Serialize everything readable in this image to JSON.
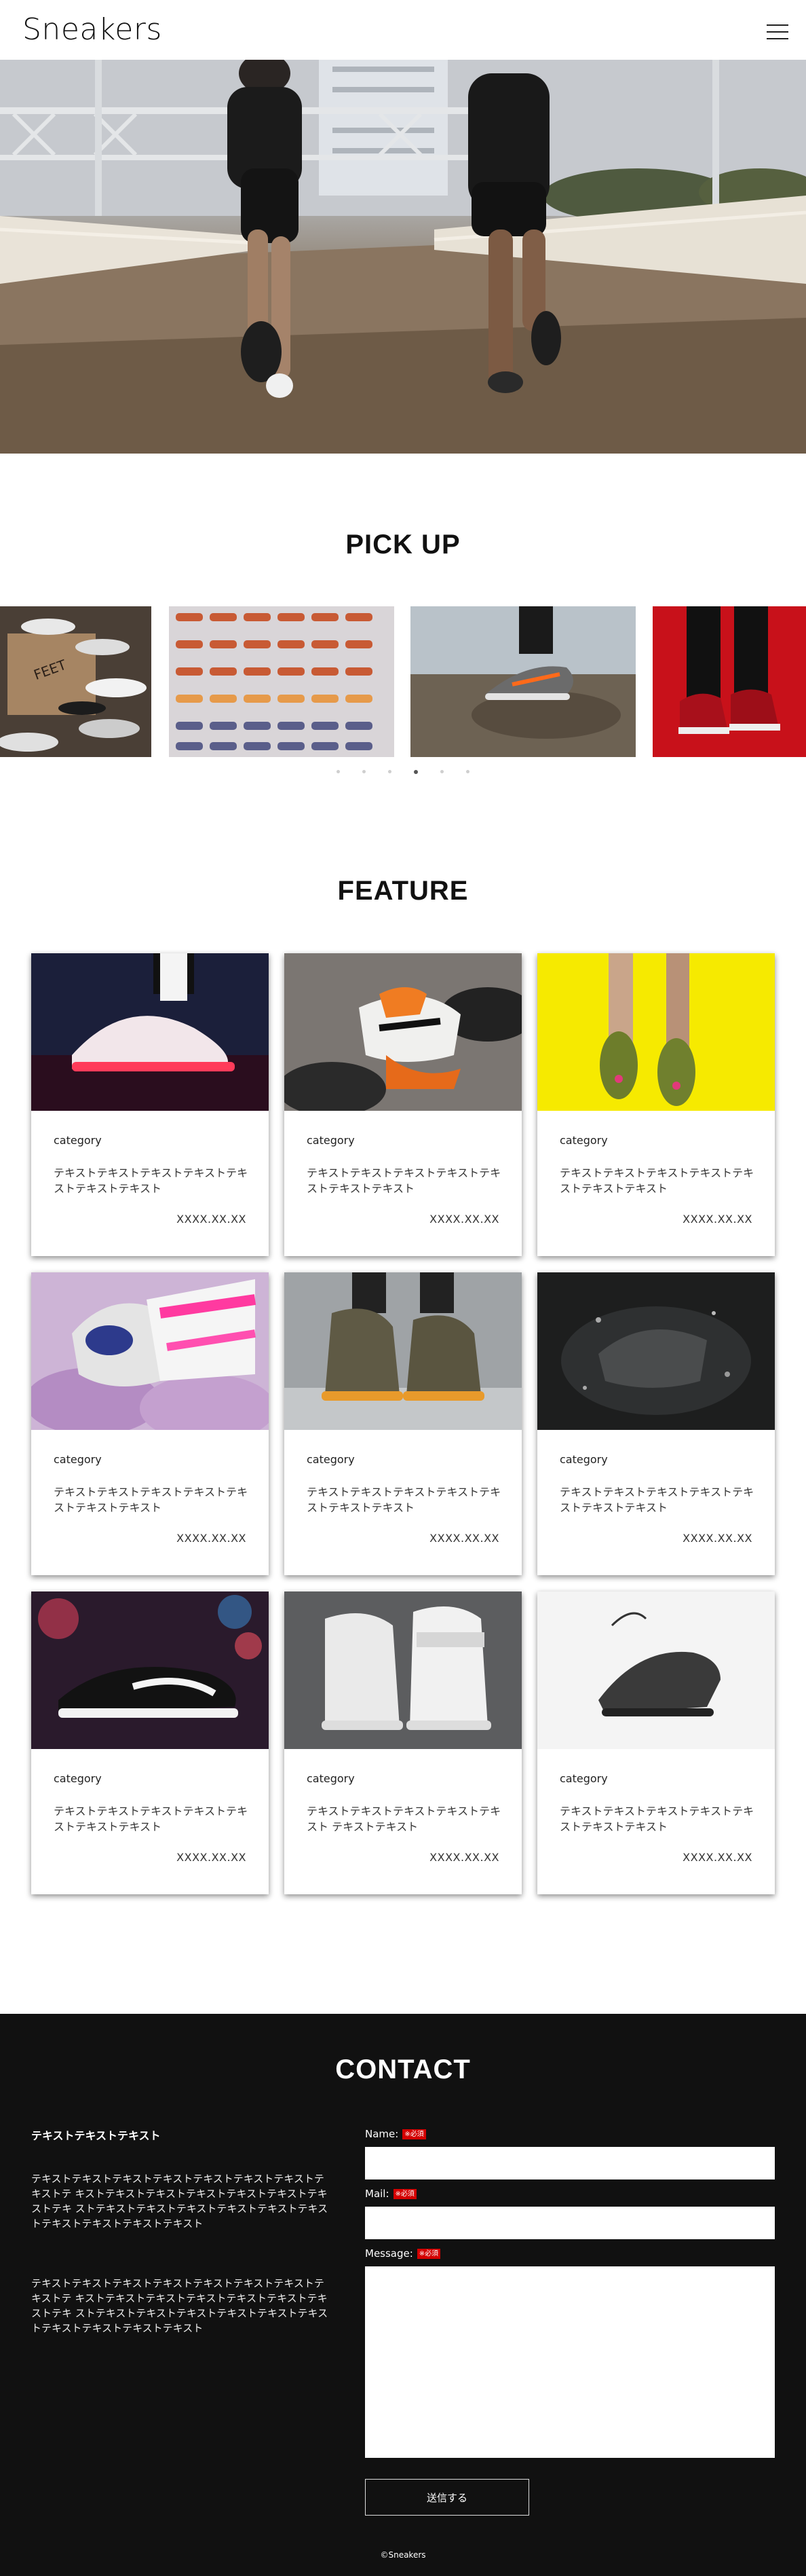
{
  "header": {
    "logo": "Sneakers",
    "menu_icon": "hamburger-icon"
  },
  "pickup": {
    "title": "PICK UP",
    "slides": [
      {
        "alt": "sneakers-shelf-photo"
      },
      {
        "alt": "sneaker-rows-photo"
      },
      {
        "alt": "sneaker-on-rock-photo"
      },
      {
        "alt": "red-sneakers-photo"
      }
    ],
    "dots_count": 6,
    "active_dot": 3
  },
  "feature": {
    "title": "FEATURE",
    "cards": [
      {
        "category": "category",
        "text": "テキストテキストテキストテキストテキ ストテキストテキスト",
        "date": "XXXX.XX.XX"
      },
      {
        "category": "category",
        "text": "テキストテキストテキストテキストテキ ストテキストテキスト",
        "date": "XXXX.XX.XX"
      },
      {
        "category": "category",
        "text": "テキストテキストテキストテキストテキ ストテキストテキスト",
        "date": "XXXX.XX.XX"
      },
      {
        "category": "category",
        "text": "テキストテキストテキストテキストテキ ストテキストテキスト",
        "date": "XXXX.XX.XX"
      },
      {
        "category": "category",
        "text": "テキストテキストテキストテキストテキ ストテキストテキスト",
        "date": "XXXX.XX.XX"
      },
      {
        "category": "category",
        "text": "テキストテキストテキストテキストテキ ストテキストテキスト",
        "date": "XXXX.XX.XX"
      },
      {
        "category": "category",
        "text": "テキストテキストテキストテキストテキ ストテキストテキスト",
        "date": "XXXX.XX.XX"
      },
      {
        "category": "category",
        "text": "テキストテキストテキストテキストテキ スト テキストテキスト",
        "date": "XXXX.XX.XX"
      },
      {
        "category": "category",
        "text": "テキストテキストテキストテキストテキ ストテキストテキスト",
        "date": "XXXX.XX.XX"
      }
    ]
  },
  "contact": {
    "title": "CONTACT",
    "lead": "テキストテキストテキスト",
    "paragraph_1": "テキストテキストテキストテキストテキストテキストテキストテキストテ キストテキストテキストテキストテキストテキストテキストテキ ストテキストテキストテキストテキストテキストテキストテキストテキストテキストテキスト",
    "paragraph_2": "テキストテキストテキストテキストテキストテキストテキストテキストテ キストテキストテキストテキストテキストテキストテキストテキ ストテキストテキストテキストテキストテキストテキストテキストテキストテキストテキスト",
    "name_label": "Name:",
    "mail_label": "Mail:",
    "message_label": "Message:",
    "required_badge": "※必須",
    "submit_label": "送信する",
    "copyright": "©Sneakers"
  }
}
